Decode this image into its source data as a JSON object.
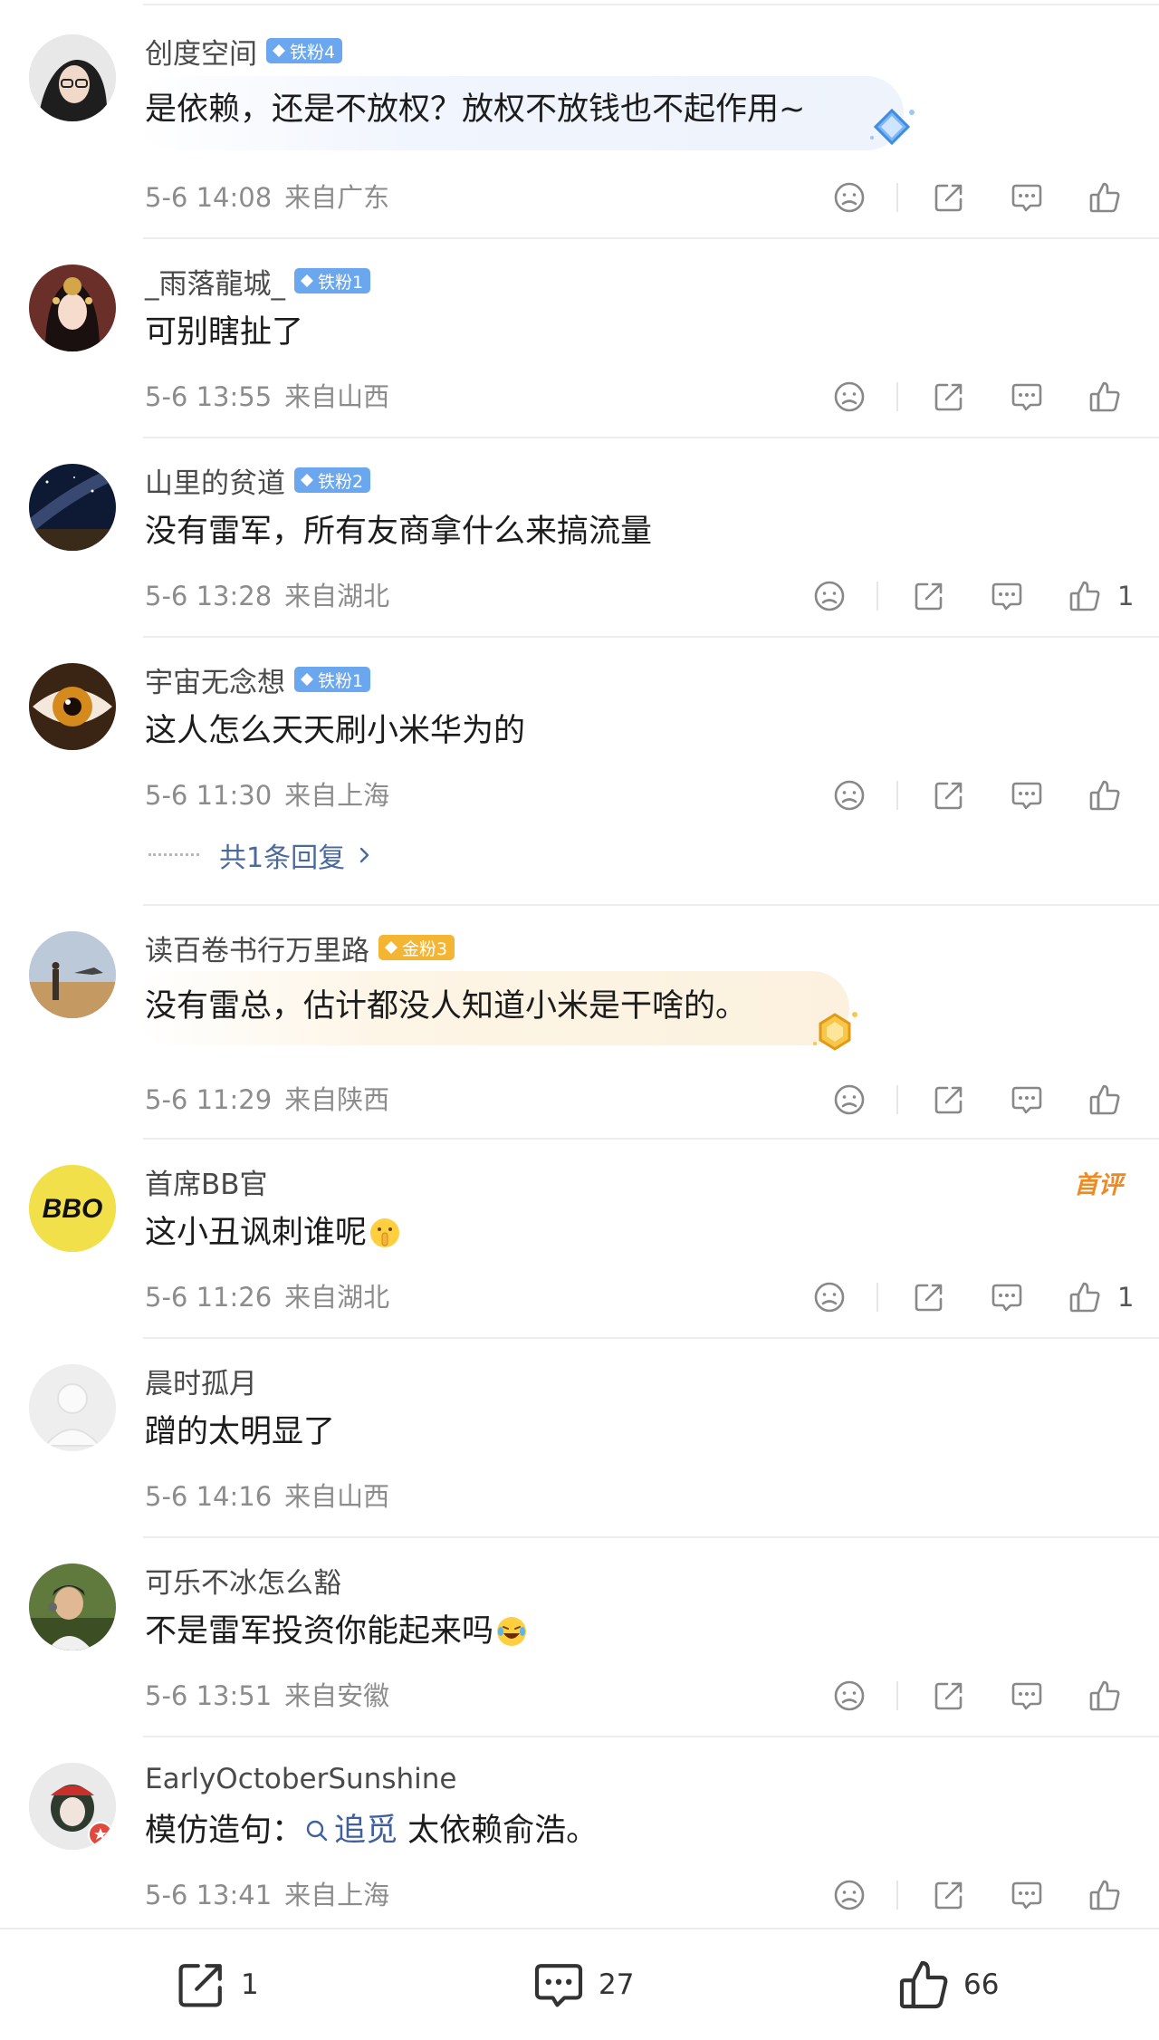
{
  "comments": [
    {
      "username": "创度空间",
      "badge": "铁粉4",
      "badge_color": "#6aa7ef",
      "text": "是依赖，还是不放权？放权不放钱也不起作用~",
      "time": "5-6 14:08",
      "location": "来自广东",
      "likes": "",
      "highlight": "blue",
      "actions": true
    },
    {
      "username": "_雨落龍城_",
      "badge": "铁粉1",
      "badge_color": "#6aa7ef",
      "text": "可别瞎扯了",
      "time": "5-6 13:55",
      "location": "来自山西",
      "likes": "",
      "actions": true
    },
    {
      "username": "山里的贫道",
      "badge": "铁粉2",
      "badge_color": "#6aa7ef",
      "text": "没有雷军，所有友商拿什么来搞流量",
      "time": "5-6 13:28",
      "location": "来自湖北",
      "likes": "1",
      "actions": true
    },
    {
      "username": "宇宙无念想",
      "badge": "铁粉1",
      "badge_color": "#6aa7ef",
      "text": "这人怎么天天刷小米华为的",
      "time": "5-6 11:30",
      "location": "来自上海",
      "likes": "",
      "actions": true,
      "replies": "共1条回复"
    },
    {
      "username": "读百卷书行万里路",
      "badge": "金粉3",
      "badge_color": "#f4b533",
      "text": "没有雷总，估计都没人知道小米是干啥的。",
      "time": "5-6 11:29",
      "location": "来自陕西",
      "likes": "",
      "highlight": "gold",
      "actions": true
    },
    {
      "username": "首席BB官",
      "badge": "",
      "text": "这小丑讽刺谁呢",
      "time": "5-6 11:26",
      "location": "来自湖北",
      "likes": "1",
      "first_comment_badge": "首评",
      "actions": true
    },
    {
      "username": "晨时孤月",
      "badge": "",
      "text": "蹭的太明显了",
      "time": "5-6 14:16",
      "location": "来自山西",
      "likes": "",
      "actions": false
    },
    {
      "username": "可乐不冰怎么豁",
      "badge": "",
      "text": "不是雷军投资你能起来吗",
      "time": "5-6 13:51",
      "location": "来自安徽",
      "likes": "",
      "actions": true
    },
    {
      "username": "EarlyOctoberSunshine",
      "badge": "",
      "text_prefix": "模仿造句：",
      "topic": "追觅",
      "text_suffix": " 太依赖俞浩。",
      "time": "5-6 13:41",
      "location": "来自上海",
      "likes": "",
      "actions": true
    }
  ],
  "avatar_labels": {
    "bbo": "BBO"
  },
  "bottom_bar": {
    "share_count": "1",
    "comment_count": "27",
    "like_count": "66"
  },
  "icons": [
    "dislike-icon",
    "share-icon",
    "comment-icon",
    "like-icon",
    "diamond-icon",
    "chevron-right-icon",
    "search-icon"
  ],
  "colors": {
    "accent_blue": "#6aa7ef",
    "gold": "#f4b533",
    "first_comment": "#ee8a22",
    "link": "#4a6a9c"
  }
}
